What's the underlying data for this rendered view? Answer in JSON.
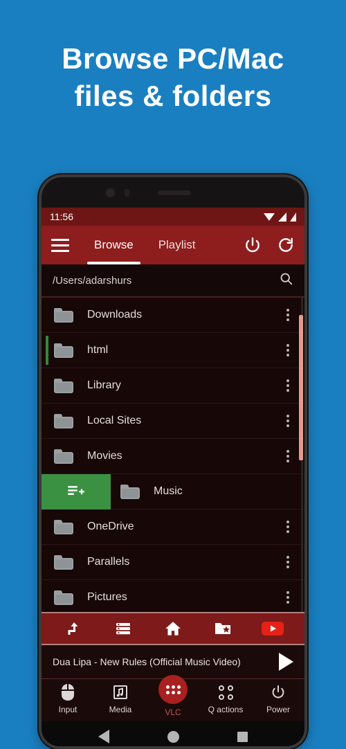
{
  "headline": {
    "line1": "Browse PC/Mac",
    "line2": "files & folders"
  },
  "statusbar": {
    "clock": "11:56",
    "wifi_icon": "wifi-icon",
    "signal_icon": "signal-icon",
    "battery_icon": "battery-icon"
  },
  "appbar": {
    "menu_icon": "hamburger-menu-icon",
    "tabs": [
      {
        "label": "Browse",
        "active": true
      },
      {
        "label": "Playlist",
        "active": false
      }
    ],
    "power_icon": "power-icon",
    "refresh_icon": "refresh-icon"
  },
  "pathbar": {
    "path": "/Users/adarshurs",
    "search_icon": "search-icon"
  },
  "filelist": {
    "kebab_icon": "more-vertical-icon",
    "swipe_action_icon": "playlist-add-icon",
    "items": [
      {
        "name": "Downloads",
        "accent": false,
        "swiped": false
      },
      {
        "name": "html",
        "accent": true,
        "swiped": false
      },
      {
        "name": "Library",
        "accent": false,
        "swiped": false
      },
      {
        "name": "Local Sites",
        "accent": false,
        "swiped": false
      },
      {
        "name": "Movies",
        "accent": false,
        "swiped": false
      },
      {
        "name": "Music",
        "accent": false,
        "swiped": true
      },
      {
        "name": "OneDrive",
        "accent": false,
        "swiped": false
      },
      {
        "name": "Parallels",
        "accent": false,
        "swiped": false
      },
      {
        "name": "Pictures",
        "accent": false,
        "swiped": false
      }
    ]
  },
  "toolbar": {
    "items": [
      {
        "icon": "up-level-icon"
      },
      {
        "icon": "list-view-icon"
      },
      {
        "icon": "home-icon"
      },
      {
        "icon": "favorite-folder-icon"
      },
      {
        "icon": "youtube-play-icon"
      }
    ]
  },
  "nowplaying": {
    "title": "Dua Lipa - New Rules (Official Music Video)",
    "play_icon": "play-icon"
  },
  "bottomnav": [
    {
      "label": "Input",
      "icon": "mouse-icon",
      "active": false
    },
    {
      "label": "Media",
      "icon": "media-note-icon",
      "active": false
    },
    {
      "label": "VLC",
      "icon": "apps-grid-icon",
      "active": true
    },
    {
      "label": "Q actions",
      "icon": "quick-actions-icon",
      "active": false
    },
    {
      "label": "Power",
      "icon": "power-icon",
      "active": false
    }
  ],
  "androidnav": {
    "back_icon": "back-triangle-icon",
    "home_icon": "home-circle-icon",
    "recents_icon": "recents-square-icon"
  },
  "colors": {
    "background_blue": "#1a7fc1",
    "appbar_red": "#8e1d1d",
    "statusbar_red": "#6e1515",
    "list_background": "#170707",
    "swipe_green": "#3a9142",
    "accent_green": "#2f8a34",
    "toolbar_red": "#7e1a1a",
    "scrollbar_thumb": "#e79b8c",
    "vlc_circle_red": "#a82020"
  }
}
